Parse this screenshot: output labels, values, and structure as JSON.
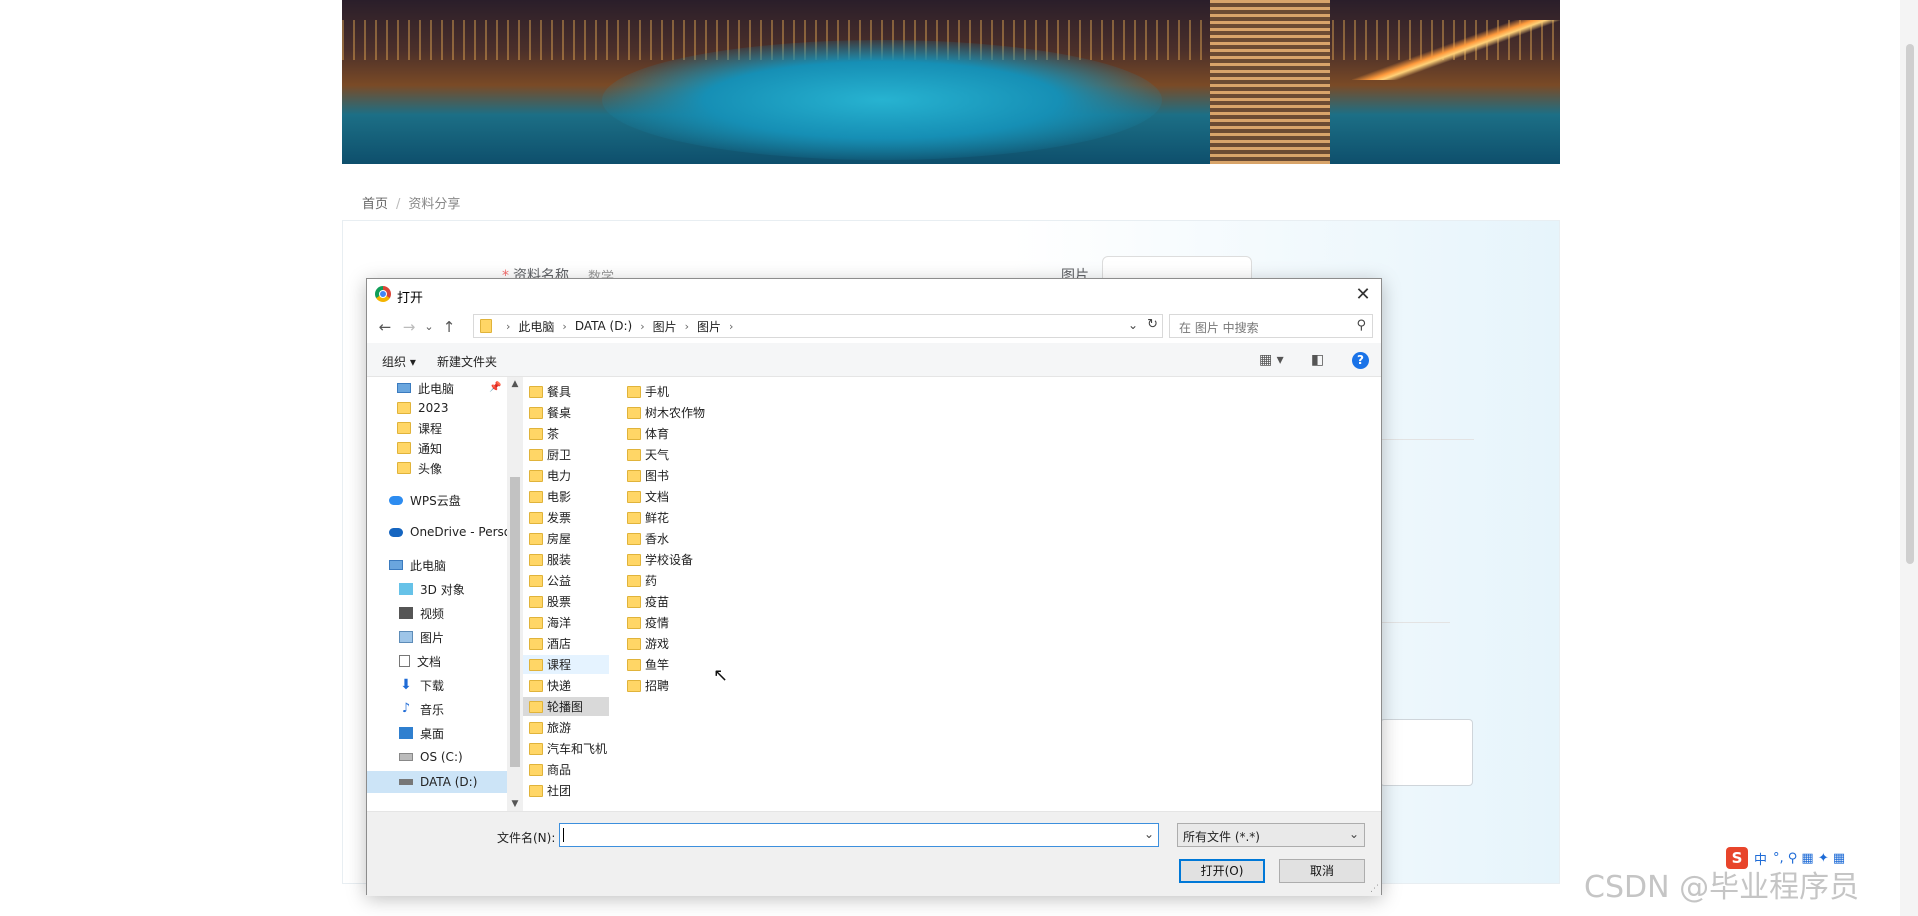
{
  "page": {
    "breadcrumb": {
      "home": "首页",
      "sep": "/",
      "current": "资料分享"
    },
    "form": {
      "name_label": "资料名称",
      "required_mark": "*",
      "name_value": "数学",
      "image_label": "图片"
    },
    "watermark": "CSDN @毕业程序员",
    "ime": {
      "logo": "S",
      "lang": "中",
      "icons": "°, ⚲ ▦ ✦ ▦"
    }
  },
  "dialog": {
    "title": "打开",
    "close": "✕",
    "nav": {
      "back": "←",
      "forward": "→",
      "recent": "⌄",
      "up": "↑"
    },
    "address": [
      "此电脑",
      "DATA (D:)",
      "图片",
      "图片"
    ],
    "address_arrow": "›",
    "search_placeholder": "在 图片 中搜索",
    "toolbar": {
      "organize": "组织 ▾",
      "new_folder": "新建文件夹",
      "help": "?"
    },
    "nav_pane": [
      {
        "label": "此电脑",
        "icon": "pc-icon"
      },
      {
        "label": "2023",
        "icon": "folder-icon"
      },
      {
        "label": "课程",
        "icon": "folder-icon"
      },
      {
        "label": "通知",
        "icon": "folder-icon"
      },
      {
        "label": "头像",
        "icon": "folder-icon"
      },
      {
        "label": "WPS云盘",
        "icon": "cloud-icon"
      },
      {
        "label": "OneDrive - Perso",
        "icon": "onedrive-icon"
      },
      {
        "label": "此电脑",
        "icon": "pc-icon"
      },
      {
        "label": "3D 对象",
        "icon": "3d-objects-icon"
      },
      {
        "label": "视频",
        "icon": "video-icon"
      },
      {
        "label": "图片",
        "icon": "pictures-icon"
      },
      {
        "label": "文档",
        "icon": "documents-icon"
      },
      {
        "label": "下载",
        "icon": "download-icon"
      },
      {
        "label": "音乐",
        "icon": "music-icon"
      },
      {
        "label": "桌面",
        "icon": "desktop-icon"
      },
      {
        "label": "OS (C:)",
        "icon": "drive-c-icon"
      },
      {
        "label": "DATA (D:)",
        "icon": "drive-d-icon"
      }
    ],
    "files_col1": [
      "餐具",
      "餐桌",
      "茶",
      "厨卫",
      "电力",
      "电影",
      "发票",
      "房屋",
      "服装",
      "公益",
      "股票",
      "海洋",
      "酒店",
      "课程",
      "快递",
      "轮播图",
      "旅游",
      "汽车和飞机",
      "商品",
      "社团"
    ],
    "files_col2": [
      "手机",
      "树木农作物",
      "体育",
      "天气",
      "图书",
      "文档",
      "鲜花",
      "香水",
      "学校设备",
      "药",
      "疫苗",
      "疫情",
      "游戏",
      "鱼竿",
      "招聘"
    ],
    "filename_label": "文件名(N):",
    "filename_value": "",
    "filter_value": "所有文件 (*.*)",
    "open_button": "打开(O)",
    "cancel_button": "取消"
  }
}
